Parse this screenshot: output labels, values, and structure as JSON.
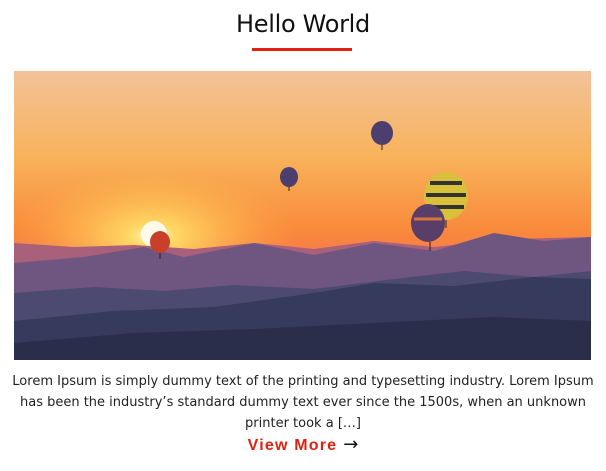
{
  "post": {
    "title": "Hello World",
    "excerpt": "Lorem Ipsum is simply dummy text of the printing and typesetting industry. Lorem Ipsum has been the industry’s standard dummy text ever since the 1500s, when an unknown printer took a […]",
    "view_more_label": "View More",
    "arrow_icon": "→"
  },
  "colors": {
    "accent": "#e0210f",
    "text": "#222222"
  }
}
